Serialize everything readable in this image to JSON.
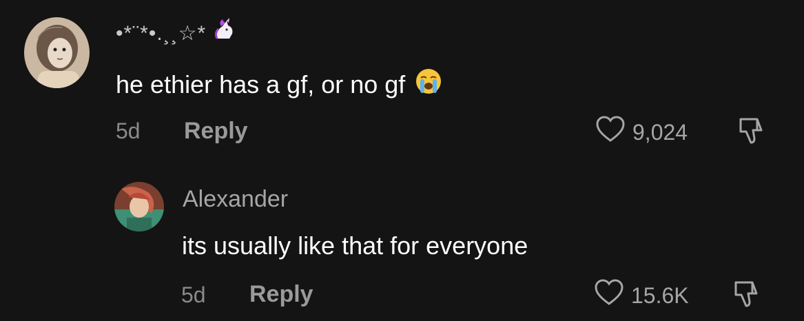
{
  "comments": [
    {
      "username": "•*¨*•.¸¸☆*",
      "username_emoji": "unicorn-icon",
      "text": "he ethier has a gf, or no gf",
      "text_emoji": "loudly-crying-face-icon",
      "time": "5d",
      "reply_label": "Reply",
      "likes": "9,024"
    },
    {
      "username": "Alexander",
      "text": "its usually like that for everyone",
      "time": "5d",
      "reply_label": "Reply",
      "likes": "15.6K"
    }
  ],
  "colors": {
    "background": "#141414",
    "primary_text": "#ffffff",
    "secondary_text": "#a6a6a6"
  }
}
